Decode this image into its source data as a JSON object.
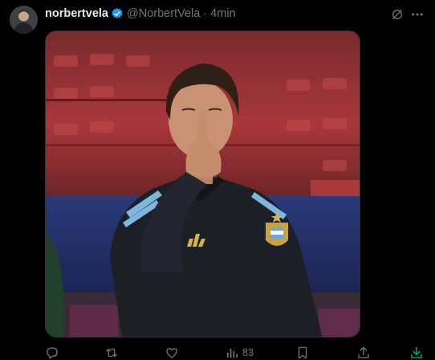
{
  "post": {
    "display_name": "norbertvela",
    "handle": "@NorbertVela",
    "separator": "·",
    "time": "4min",
    "verified": true
  },
  "icons": {
    "verified": "verified-badge-icon",
    "grok": "grok-icon",
    "more": "more-icon",
    "reply": "reply-icon",
    "repost": "repost-icon",
    "like": "like-icon",
    "views": "views-icon",
    "bookmark": "bookmark-icon",
    "share": "share-icon",
    "download": "download-icon"
  },
  "actions": {
    "views_count": "83"
  },
  "colors": {
    "background": "#000000",
    "text_primary": "#e7e9ea",
    "text_secondary": "#71767b",
    "verified_blue": "#1d9bf0",
    "download_green": "#00ba7c"
  }
}
